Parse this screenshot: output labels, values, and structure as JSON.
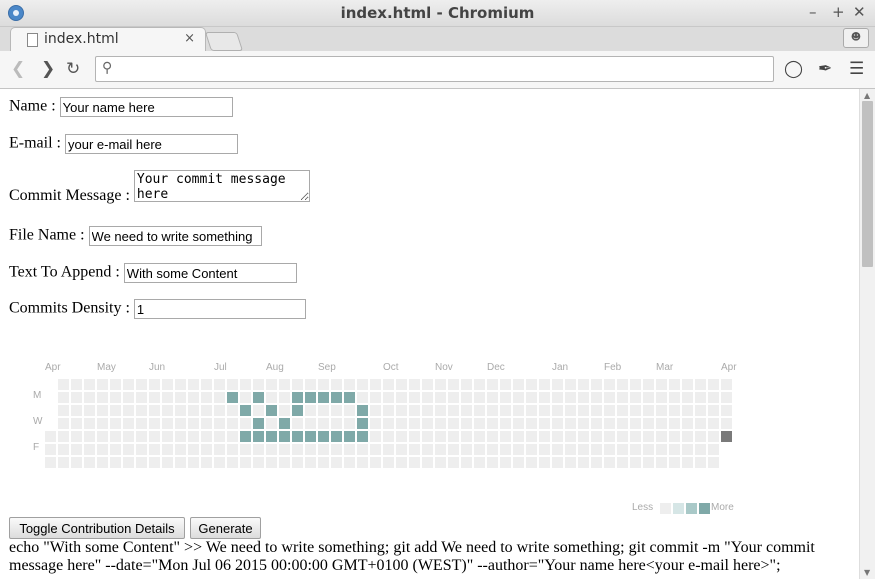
{
  "window": {
    "title": "index.html - Chromium",
    "controls": [
      "–",
      "+",
      "✕"
    ]
  },
  "tab": {
    "label": "index.html",
    "close": "×"
  },
  "toolbar": {
    "url_value": ""
  },
  "form": {
    "name_label": "Name :",
    "name_value": "Your name here",
    "email_label": "E-mail :",
    "email_value": "your e-mail here",
    "commit_label": "Commit Message :",
    "commit_value": "Your commit message here",
    "file_label": "File Name :",
    "file_value": "We need to write something",
    "append_label": "Text To Append :",
    "append_value": "With some Content",
    "density_label": "Commits Density :",
    "density_value": "1"
  },
  "contributions": {
    "months": [
      "Apr",
      "May",
      "Jun",
      "Jul",
      "Aug",
      "Sep",
      "Oct",
      "Nov",
      "Dec",
      "Jan",
      "Feb",
      "Mar",
      "Apr"
    ],
    "day_labels": [
      "M",
      "W",
      "F"
    ],
    "legend_less": "Less",
    "legend_more": "More",
    "colors": {
      "empty": "#eeeeee",
      "filled": "#7fa9a8",
      "light1": "#d6e6e6",
      "light2": "#a9c9c8",
      "last": "#7a7a7a"
    },
    "filled_cells": [
      [
        14,
        1
      ],
      [
        16,
        1
      ],
      [
        15,
        2
      ],
      [
        17,
        2
      ],
      [
        16,
        3
      ],
      [
        19,
        1
      ],
      [
        20,
        1
      ],
      [
        21,
        1
      ],
      [
        22,
        1
      ],
      [
        23,
        1
      ],
      [
        19,
        2
      ],
      [
        24,
        2
      ],
      [
        18,
        3
      ],
      [
        24,
        3
      ],
      [
        15,
        4
      ],
      [
        16,
        4
      ],
      [
        17,
        4
      ],
      [
        18,
        4
      ],
      [
        19,
        4
      ],
      [
        20,
        4
      ],
      [
        21,
        4
      ],
      [
        22,
        4
      ],
      [
        23,
        4
      ],
      [
        24,
        4
      ]
    ],
    "last_cell": [
      52,
      4
    ]
  },
  "buttons": {
    "toggle": "Toggle Contribution Details",
    "generate": "Generate"
  },
  "output": "echo \"With some Content\" >> We need to write something; git add We need to write something; git commit -m \"Your commit message here\" --date=\"Mon Jul 06 2015 00:00:00 GMT+0100 (WEST)\" --author=\"Your name here<your e-mail here>\";"
}
